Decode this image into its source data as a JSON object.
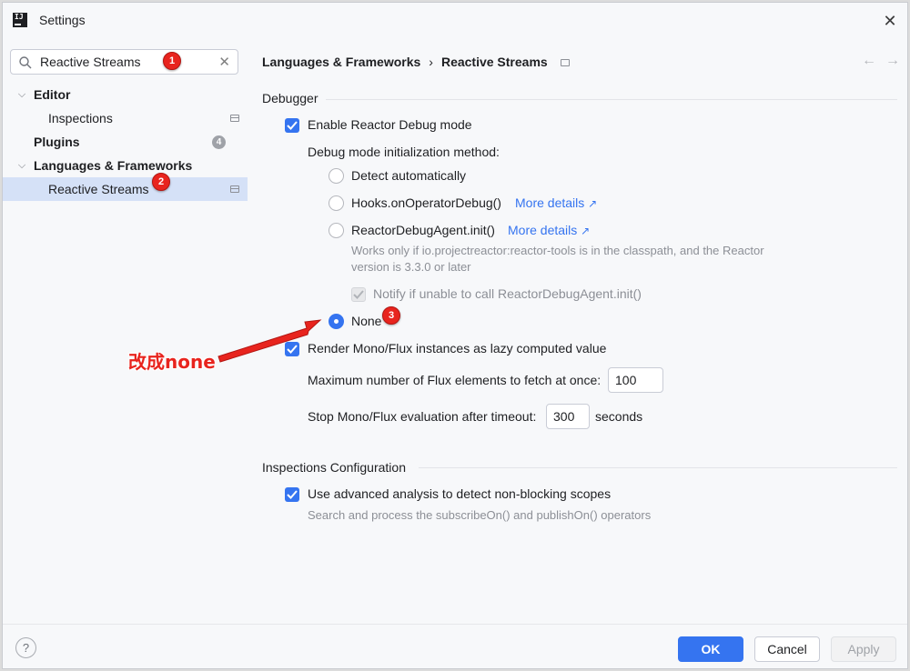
{
  "window": {
    "title": "Settings",
    "close_glyph": "✕"
  },
  "sidebar": {
    "search": {
      "value": "Reactive Streams",
      "clear_glyph": "✕"
    },
    "items": [
      {
        "label": "Editor",
        "chevron": "⌵"
      },
      {
        "label": "Inspections"
      },
      {
        "label": "Plugins",
        "count": "4"
      },
      {
        "label": "Languages & Frameworks",
        "chevron": "⌵"
      },
      {
        "label": "Reactive Streams"
      }
    ]
  },
  "breadcrumb": {
    "parent": "Languages & Frameworks",
    "separator": "›",
    "current": "Reactive Streams",
    "back_glyph": "←",
    "forward_glyph": "→"
  },
  "debugger": {
    "section_title": "Debugger",
    "enable_label": "Enable Reactor Debug mode",
    "method_label": "Debug mode initialization method:",
    "options": {
      "detect": "Detect automatically",
      "hooks": "Hooks.onOperatorDebug()",
      "agent": "ReactorDebugAgent.init()",
      "none": "None"
    },
    "more_details": "More details",
    "ext_glyph": "↗",
    "agent_hint_line1": "Works only if io.projectreactor:reactor-tools is in the classpath, and the Reactor",
    "agent_hint_line2": "version is 3.3.0 or later",
    "notify_label": "Notify if unable to call ReactorDebugAgent.init()",
    "selected_option": "None",
    "render_label": "Render Mono/Flux instances as lazy computed value",
    "max_label": "Maximum number of Flux elements to fetch at once:",
    "max_value": "100",
    "timeout_label": "Stop Mono/Flux evaluation after timeout:",
    "timeout_value": "300",
    "timeout_unit": "seconds"
  },
  "inspections": {
    "section_title": "Inspections Configuration",
    "advanced_label": "Use advanced analysis to detect non-blocking scopes",
    "advanced_hint": "Search and process the subscribeOn() and publishOn() operators"
  },
  "footer": {
    "help": "?",
    "ok": "OK",
    "cancel": "Cancel",
    "apply": "Apply"
  },
  "annotations": {
    "marker1": "1",
    "marker2": "2",
    "marker3": "3",
    "callout": "改成none",
    "color": "#e8241e"
  },
  "colors": {
    "accent": "#3574f0",
    "selection": "#d5e1f7",
    "background": "#f7f8fa"
  }
}
